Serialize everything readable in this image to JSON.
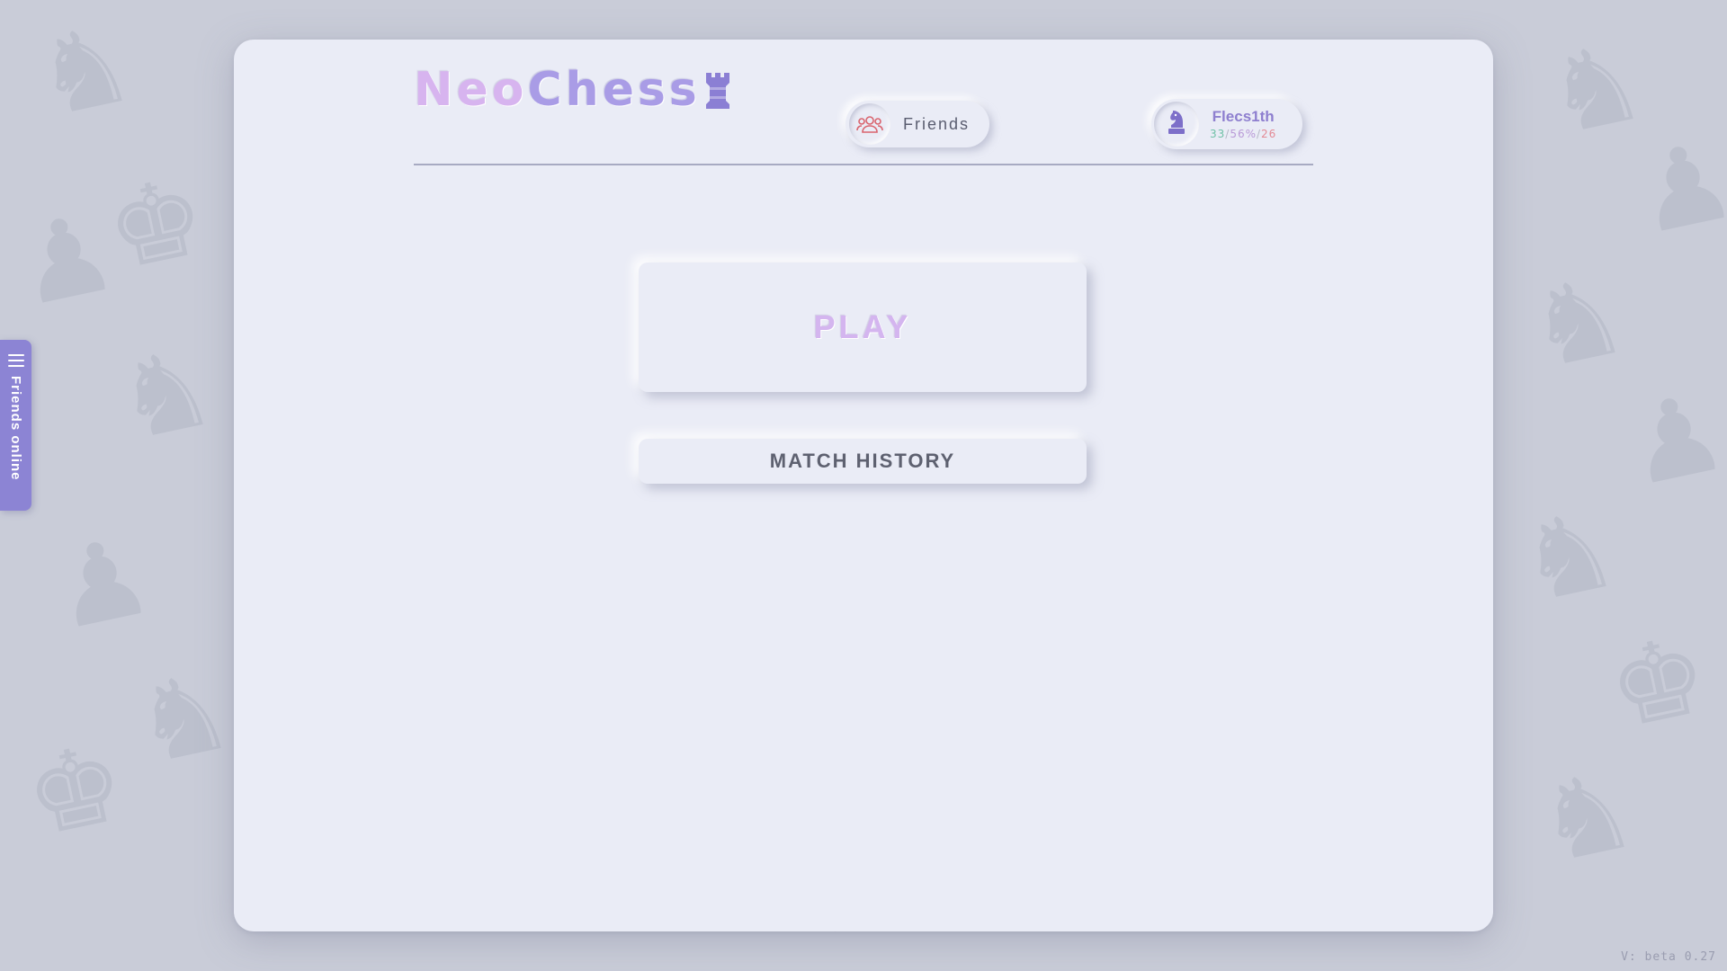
{
  "app": {
    "logo_part1": "Neo",
    "logo_part2": "Chess",
    "logo_icon": "rook-icon"
  },
  "header": {
    "friends_label": "Friends",
    "friends_icon": "users-icon"
  },
  "profile": {
    "username": "Flecs1th",
    "avatar_icon": "knight-icon",
    "wins": "33",
    "win_rate": "56%",
    "losses": "26",
    "separator": "/"
  },
  "main": {
    "play_label": "PLAY",
    "history_label": "MATCH HISTORY"
  },
  "sidebar": {
    "label": "Friends online",
    "icon": "hamburger-icon"
  },
  "footer": {
    "version": "V: beta 0.27"
  },
  "colors": {
    "accent": "#8c84d4",
    "background": "#c9ccd8",
    "card": "#eaecf6",
    "logo_light": "#d7b4ef",
    "logo_dark": "#a99ce6",
    "wins": "#6fc1a6",
    "losses": "#e38a95"
  }
}
